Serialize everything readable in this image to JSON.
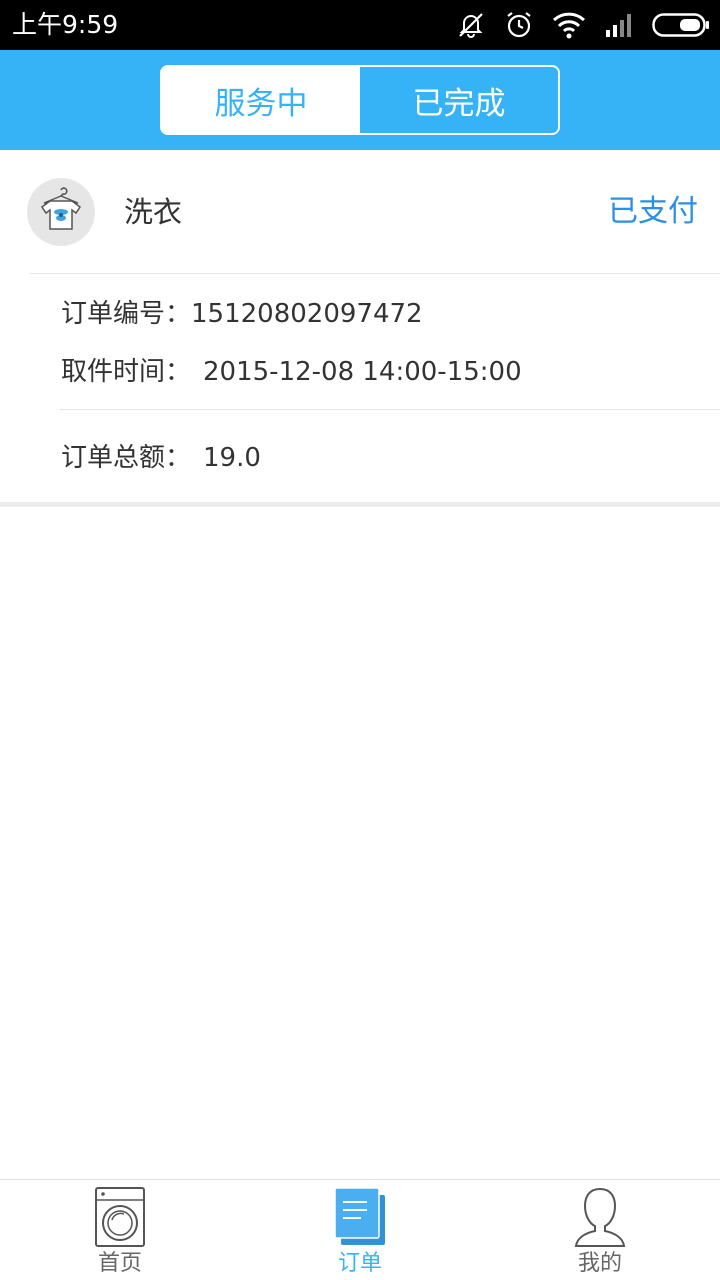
{
  "status_bar": {
    "time": "上午9:59"
  },
  "header": {
    "tabs": [
      {
        "label": "服务中",
        "active": true
      },
      {
        "label": "已完成",
        "active": false
      }
    ]
  },
  "order": {
    "service_icon": "tshirt-hanger-icon",
    "service_name": "洗衣",
    "status": "已支付",
    "number_label": "订单编号：",
    "number_value": "15120802097472",
    "time_label": "取件时间：",
    "time_value": "2015-12-08 14:00-15:00",
    "total_label": "订单总额：",
    "total_value": "19.0"
  },
  "bottom_nav": {
    "items": [
      {
        "label": "首页",
        "icon": "washing-machine-icon",
        "active": false
      },
      {
        "label": "订单",
        "icon": "document-icon",
        "active": true
      },
      {
        "label": "我的",
        "icon": "person-icon",
        "active": false
      }
    ]
  },
  "colors": {
    "accent": "#36b3f6",
    "status_text": "#2a8fe6",
    "text": "#333333"
  }
}
